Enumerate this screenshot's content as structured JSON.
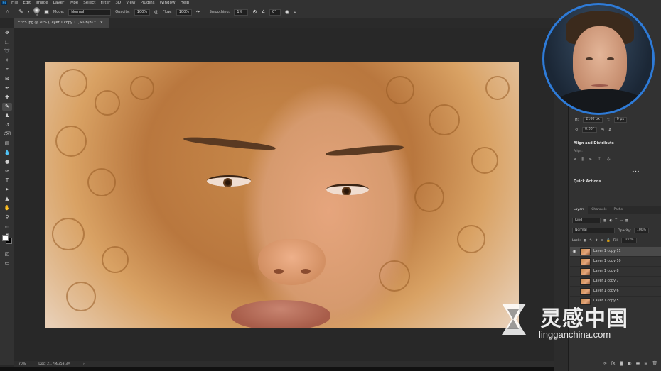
{
  "app": {
    "logo_text": "Ps"
  },
  "menu": [
    "File",
    "Edit",
    "Image",
    "Layer",
    "Type",
    "Select",
    "Filter",
    "3D",
    "View",
    "Plugins",
    "Window",
    "Help"
  ],
  "options_bar": {
    "brush_size": "30",
    "mode_label": "Mode:",
    "mode_value": "Normal",
    "opacity_label": "Opacity:",
    "opacity_value": "100%",
    "flow_label": "Flow:",
    "flow_value": "100%",
    "smoothing_label": "Smoothing:",
    "smoothing_value": "1%",
    "angle_value": "0°"
  },
  "document_tab": {
    "title": "EYES.jpg @ 70% (Layer 1 copy 11, RGB/8) *",
    "close": "×"
  },
  "status_bar": {
    "zoom": "70%",
    "doc_info": "Doc: 21.7M/353.3M",
    "arrow": "›"
  },
  "properties": {
    "h_label": "H:",
    "h_value": "2160 px",
    "y_label": "Y:",
    "y_value": "0 px",
    "angle_value": "0.00°"
  },
  "align_panel": {
    "title": "Align and Distribute",
    "align_label": "Align:",
    "more": "•••"
  },
  "quick_actions": {
    "title": "Quick Actions"
  },
  "layers_panel": {
    "tabs": [
      "Layers",
      "Channels",
      "Paths"
    ],
    "kind_value": "Kind",
    "blend_value": "Normal",
    "opacity_label": "Opacity:",
    "opacity_value": "100%",
    "lock_label": "Lock:",
    "fill_label": "Fill:",
    "fill_value": "100%",
    "layers": [
      {
        "name": "Layer 1 copy 11",
        "selected": true
      },
      {
        "name": "Layer 1 copy 10",
        "selected": false
      },
      {
        "name": "Layer 1 copy 8",
        "selected": false
      },
      {
        "name": "Layer 1 copy 7",
        "selected": false
      },
      {
        "name": "Layer 1 copy 6",
        "selected": false
      },
      {
        "name": "Layer 1 copy 5",
        "selected": false
      }
    ]
  },
  "watermark": {
    "chinese": "灵感中国",
    "domain": "lingganchina.com"
  },
  "colors": {
    "accent": "#2e7bd8",
    "panel_bg": "#323232",
    "canvas_bg": "#282828",
    "foreground": "#ffffff",
    "background": "#000000"
  }
}
